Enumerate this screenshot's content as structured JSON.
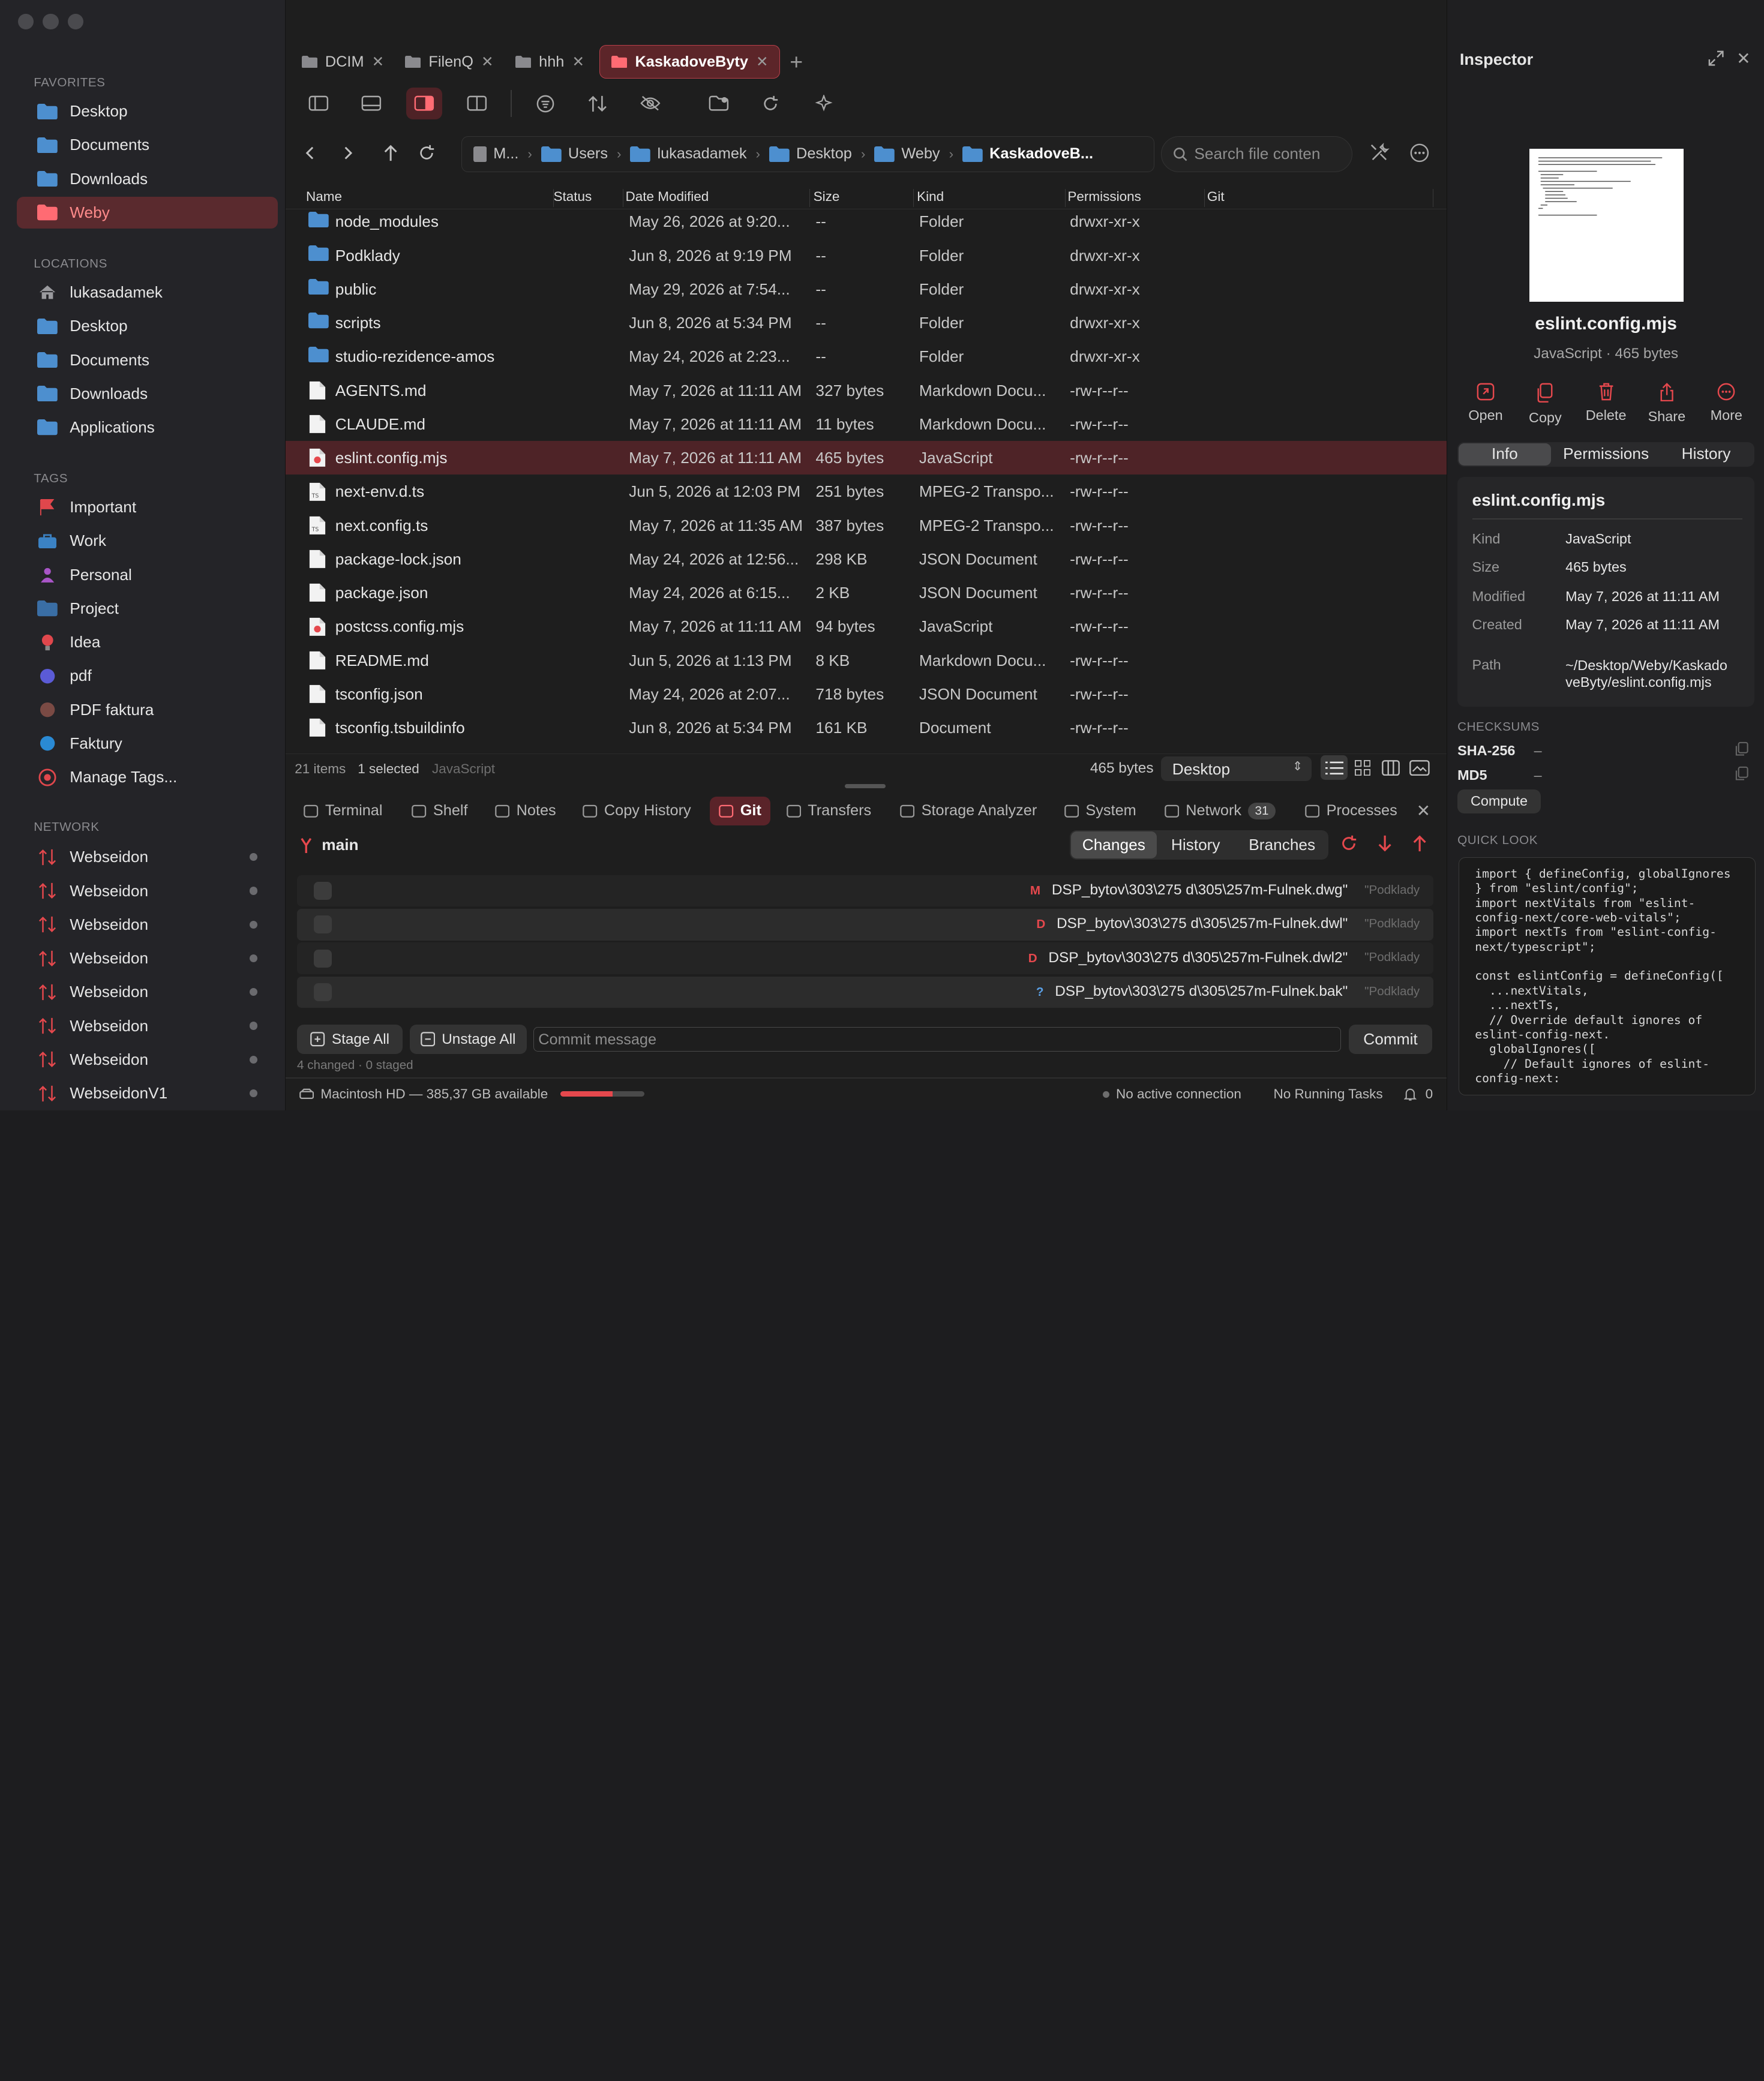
{
  "sidebar": {
    "favorites_title": "FAVORITES",
    "favorites": [
      "Desktop",
      "Documents",
      "Downloads",
      "Weby"
    ],
    "locations_title": "LOCATIONS",
    "locations": [
      "lukasadamek",
      "Desktop",
      "Documents",
      "Downloads",
      "Applications"
    ],
    "tags_title": "TAGS",
    "tags": [
      {
        "label": "Important",
        "color": "#e0474c"
      },
      {
        "label": "Work",
        "color": "#3b82c4"
      },
      {
        "label": "Personal",
        "color": "#a855c7"
      },
      {
        "label": "Project",
        "color": "#3a6ea5"
      },
      {
        "label": "Idea",
        "color": "#e0474c"
      },
      {
        "label": "pdf",
        "color": "#5b5bd6"
      },
      {
        "label": "PDF faktura",
        "color": "#7a4a44"
      },
      {
        "label": "Faktury",
        "color": "#2a8ad4"
      },
      {
        "label": "Manage Tags...",
        "color": "#e0474c"
      }
    ],
    "network_title": "NETWORK",
    "network": [
      "Webseidon",
      "Webseidon",
      "Webseidon",
      "Webseidon",
      "Webseidon",
      "Webseidon",
      "Webseidon",
      "WebseidonV1"
    ]
  },
  "tabs": [
    {
      "label": "DCIM"
    },
    {
      "label": "FilenQ"
    },
    {
      "label": "hhh"
    },
    {
      "label": "KaskadoveByty"
    }
  ],
  "breadcrumb": [
    "M...",
    "Users",
    "lukasadamek",
    "Desktop",
    "Weby",
    "KaskadoveB..."
  ],
  "search": {
    "placeholder": "Search file conten"
  },
  "columns": [
    "Name",
    "Status",
    "Date Modified",
    "Size",
    "Kind",
    "Permissions",
    "Git"
  ],
  "files": [
    {
      "name": "node_modules",
      "date": "May 26, 2026 at 9:20...",
      "size": "--",
      "kind": "Folder",
      "perm": "drwxr-xr-x",
      "type": "folder"
    },
    {
      "name": "Podklady",
      "date": "Jun 8, 2026 at 9:19 PM",
      "size": "--",
      "kind": "Folder",
      "perm": "drwxr-xr-x",
      "type": "folder"
    },
    {
      "name": "public",
      "date": "May 29, 2026 at 7:54...",
      "size": "--",
      "kind": "Folder",
      "perm": "drwxr-xr-x",
      "type": "folder"
    },
    {
      "name": "scripts",
      "date": "Jun 8, 2026 at 5:34 PM",
      "size": "--",
      "kind": "Folder",
      "perm": "drwxr-xr-x",
      "type": "folder"
    },
    {
      "name": "studio-rezidence-amos",
      "date": "May 24, 2026 at 2:23...",
      "size": "--",
      "kind": "Folder",
      "perm": "drwxr-xr-x",
      "type": "folder"
    },
    {
      "name": "AGENTS.md",
      "date": "May 7, 2026 at 11:11 AM",
      "size": "327 bytes",
      "kind": "Markdown Docu...",
      "perm": "-rw-r--r--",
      "type": "doc"
    },
    {
      "name": "CLAUDE.md",
      "date": "May 7, 2026 at 11:11 AM",
      "size": "11 bytes",
      "kind": "Markdown Docu...",
      "perm": "-rw-r--r--",
      "type": "doc"
    },
    {
      "name": "eslint.config.mjs",
      "date": "May 7, 2026 at 11:11 AM",
      "size": "465 bytes",
      "kind": "JavaScript",
      "perm": "-rw-r--r--",
      "type": "js"
    },
    {
      "name": "next-env.d.ts",
      "date": "Jun 5, 2026 at 12:03 PM",
      "size": "251 bytes",
      "kind": "MPEG-2 Transpo...",
      "perm": "-rw-r--r--",
      "type": "ts"
    },
    {
      "name": "next.config.ts",
      "date": "May 7, 2026 at 11:35 AM",
      "size": "387 bytes",
      "kind": "MPEG-2 Transpo...",
      "perm": "-rw-r--r--",
      "type": "ts"
    },
    {
      "name": "package-lock.json",
      "date": "May 24, 2026 at 12:56...",
      "size": "298 KB",
      "kind": "JSON Document",
      "perm": "-rw-r--r--",
      "type": "doc"
    },
    {
      "name": "package.json",
      "date": "May 24, 2026 at 6:15...",
      "size": "2 KB",
      "kind": "JSON Document",
      "perm": "-rw-r--r--",
      "type": "doc"
    },
    {
      "name": "postcss.config.mjs",
      "date": "May 7, 2026 at 11:11 AM",
      "size": "94 bytes",
      "kind": "JavaScript",
      "perm": "-rw-r--r--",
      "type": "js"
    },
    {
      "name": "README.md",
      "date": "Jun 5, 2026 at 1:13 PM",
      "size": "8 KB",
      "kind": "Markdown Docu...",
      "perm": "-rw-r--r--",
      "type": "doc"
    },
    {
      "name": "tsconfig.json",
      "date": "May 24, 2026 at 2:07...",
      "size": "718 bytes",
      "kind": "JSON Document",
      "perm": "-rw-r--r--",
      "type": "doc"
    },
    {
      "name": "tsconfig.tsbuildinfo",
      "date": "Jun 8, 2026 at 5:34 PM",
      "size": "161 KB",
      "kind": "Document",
      "perm": "-rw-r--r--",
      "type": "doc"
    }
  ],
  "selected_index": 7,
  "status": {
    "items": "21 items",
    "selected": "1 selected",
    "kind": "JavaScript",
    "size": "465 bytes",
    "location": "Desktop"
  },
  "panel_tabs": [
    {
      "label": "Terminal"
    },
    {
      "label": "Shelf"
    },
    {
      "label": "Notes"
    },
    {
      "label": "Copy History"
    },
    {
      "label": "Git"
    },
    {
      "label": "Transfers"
    },
    {
      "label": "Storage Analyzer"
    },
    {
      "label": "System"
    },
    {
      "label": "Network",
      "badge": "31"
    },
    {
      "label": "Processes"
    }
  ],
  "git": {
    "branch": "main",
    "views": [
      "Changes",
      "History",
      "Branches"
    ],
    "changes": [
      {
        "status": "M",
        "color": "#e5484d",
        "file": "DSP_bytov\\303\\275 d\\305\\257m-Fulnek.dwg\"",
        "dir": "\"Podklady"
      },
      {
        "status": "D",
        "color": "#e5484d",
        "file": "DSP_bytov\\303\\275 d\\305\\257m-Fulnek.dwl\"",
        "dir": "\"Podklady"
      },
      {
        "status": "D",
        "color": "#e5484d",
        "file": "DSP_bytov\\303\\275 d\\305\\257m-Fulnek.dwl2\"",
        "dir": "\"Podklady"
      },
      {
        "status": "?",
        "color": "#5aa0e6",
        "file": "DSP_bytov\\303\\275 d\\305\\257m-Fulnek.bak\"",
        "dir": "\"Podklady"
      }
    ],
    "stage_all": "Stage All",
    "unstage_all": "Unstage All",
    "commit_placeholder": "Commit message",
    "commit": "Commit",
    "summary": "4 changed · 0 staged"
  },
  "bottom": {
    "disk": "Macintosh HD — 385,37 GB available",
    "disk_used_fraction": 0.62,
    "connection": "No active connection",
    "tasks": "No Running Tasks",
    "notifications": "0"
  },
  "inspector": {
    "title": "Inspector",
    "filename": "eslint.config.mjs",
    "subtitle": "JavaScript · 465 bytes",
    "actions": [
      "Open",
      "Copy",
      "Delete",
      "Share",
      "More"
    ],
    "segments": [
      "Info",
      "Permissions",
      "History"
    ],
    "info_title": "eslint.config.mjs",
    "info": [
      {
        "key": "Kind",
        "value": "JavaScript"
      },
      {
        "key": "Size",
        "value": "465 bytes"
      },
      {
        "key": "Modified",
        "value": "May 7, 2026 at 11:11 AM"
      },
      {
        "key": "Created",
        "value": "May 7, 2026 at 11:11 AM"
      },
      {
        "key": "Path",
        "value": "~/Desktop/Weby/KaskadoveByty/eslint.config.mjs"
      }
    ],
    "checksums_title": "CHECKSUMS",
    "checksums": [
      {
        "key": "SHA-256",
        "value": "–"
      },
      {
        "key": "MD5",
        "value": "–"
      }
    ],
    "compute": "Compute",
    "quicklook_title": "QUICK LOOK",
    "quicklook": "import { defineConfig, globalIgnores } from \"eslint/config\";\nimport nextVitals from \"eslint-config-next/core-web-vitals\";\nimport nextTs from \"eslint-config-next/typescript\";\n\nconst eslintConfig = defineConfig([\n  ...nextVitals,\n  ...nextTs,\n  // Override default ignores of eslint-config-next.\n  globalIgnores([\n    // Default ignores of eslint-config-next:"
  },
  "accent": "#e5484d"
}
